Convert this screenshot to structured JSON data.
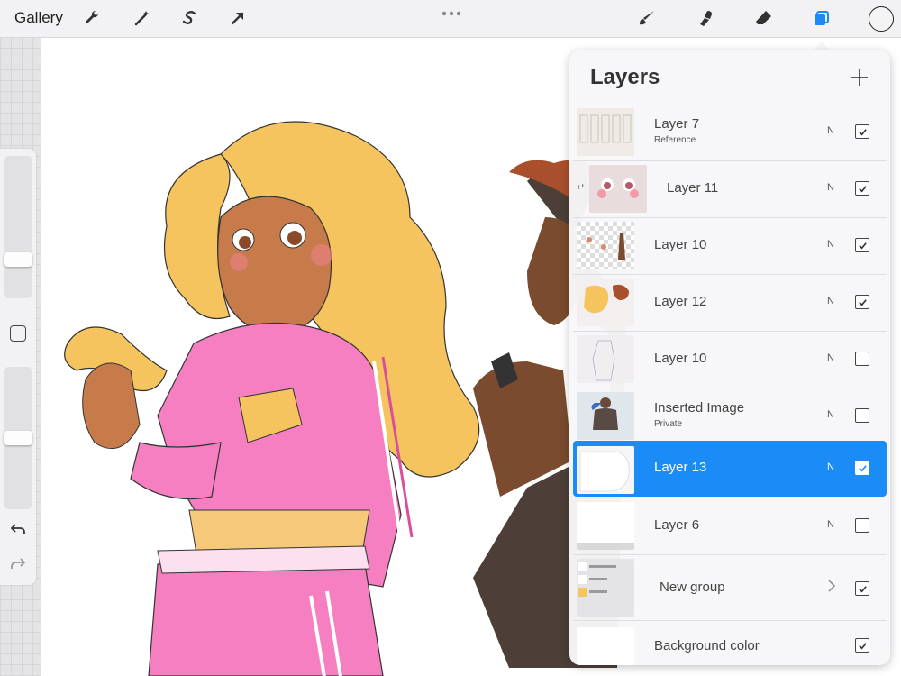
{
  "topbar": {
    "gallery_label": "Gallery",
    "tools_left": [
      {
        "icon": "wrench-icon"
      },
      {
        "icon": "magic-wand-icon"
      },
      {
        "icon": "selection-s-icon"
      },
      {
        "icon": "transform-arrow-icon"
      }
    ],
    "tools_right": [
      {
        "icon": "brush-icon"
      },
      {
        "icon": "smudge-icon"
      },
      {
        "icon": "eraser-icon"
      },
      {
        "icon": "layers-icon",
        "active": true,
        "color": "#1b8cf6"
      }
    ],
    "current_color": "#f4f4f4"
  },
  "sidebar": {
    "brush_size_level": 0.25,
    "opacity_level": 0.5
  },
  "layers_panel": {
    "title": "Layers",
    "add_icon": "plus-icon",
    "layers": [
      {
        "name": "Layer 7",
        "subtitle": "Reference",
        "blend": "N",
        "visible": true,
        "selected": false
      },
      {
        "name": "Layer 11",
        "subtitle": "",
        "blend": "N",
        "visible": true,
        "selected": false,
        "clipped": true
      },
      {
        "name": "Layer 10",
        "subtitle": "",
        "blend": "N",
        "visible": true,
        "selected": false
      },
      {
        "name": "Layer 12",
        "subtitle": "",
        "blend": "N",
        "visible": true,
        "selected": false
      },
      {
        "name": "Layer 10",
        "subtitle": "",
        "blend": "N",
        "visible": false,
        "selected": false
      },
      {
        "name": "Inserted Image",
        "subtitle": "Private",
        "blend": "N",
        "visible": false,
        "selected": false
      },
      {
        "name": "Layer 13",
        "subtitle": "",
        "blend": "N",
        "visible": true,
        "selected": true
      },
      {
        "name": "Layer 6",
        "subtitle": "",
        "blend": "N",
        "visible": false,
        "selected": false
      }
    ],
    "group": {
      "name": "New group",
      "visible": true
    },
    "background": {
      "name": "Background color",
      "visible": true
    },
    "accent_color": "#1b8cf6"
  }
}
